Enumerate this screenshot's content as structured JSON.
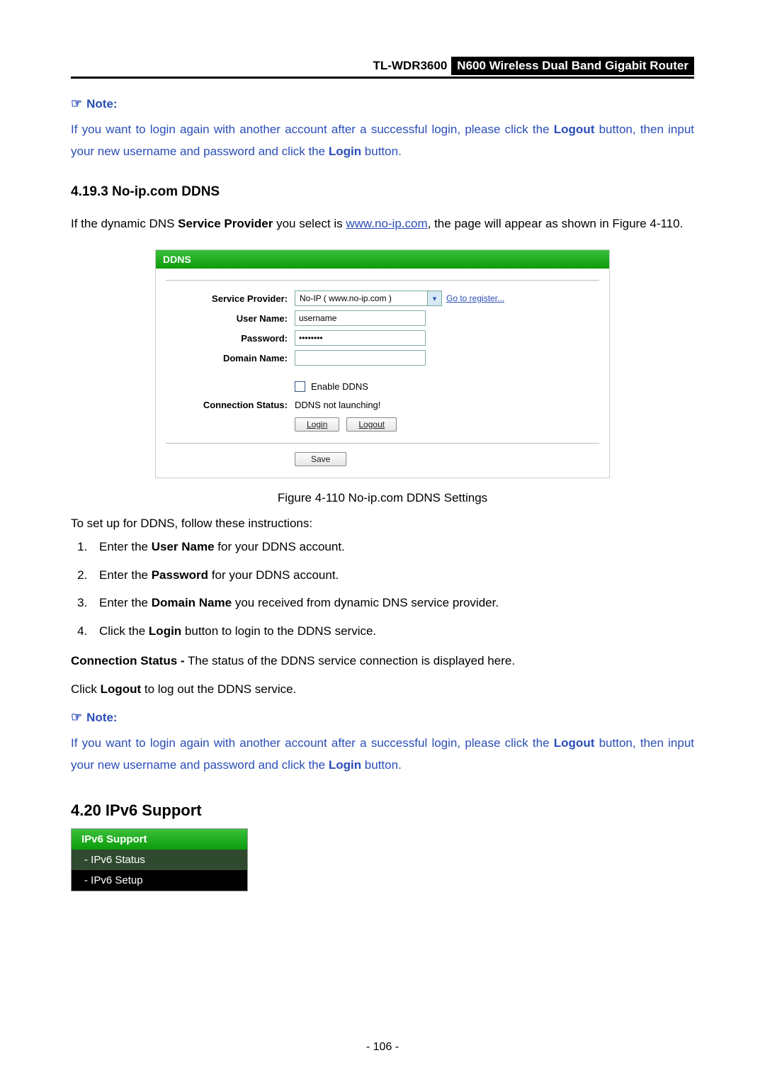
{
  "header": {
    "model": "TL-WDR3600",
    "product": "N600 Wireless Dual Band Gigabit Router"
  },
  "note1": {
    "label": "Note:",
    "prefix": " If you want to login again with another account after a successful login, please click the ",
    "logout": "Logout",
    "mid": " button, then input your new username and password and click the ",
    "login": "Login",
    "suffix": " button."
  },
  "section": {
    "heading": "4.19.3  No-ip.com DDNS",
    "intro_pre": "If the dynamic DNS ",
    "intro_sp": "Service Provider",
    "intro_mid": " you select is ",
    "intro_link": "www.no-ip.com",
    "intro_post": ", the page will appear as shown in Figure 4-110."
  },
  "ddns": {
    "panel_title": "DDNS",
    "labels": {
      "service_provider": "Service Provider:",
      "user_name": "User Name:",
      "password": "Password:",
      "domain_name": "Domain Name:",
      "connection_status": "Connection Status:"
    },
    "fields": {
      "provider_option": "No-IP ( www.no-ip.com )",
      "register_link": "Go to register...",
      "user_name_value": "username",
      "password_value": "••••••••",
      "domain_value": "",
      "enable_label": "Enable DDNS",
      "status_text": "DDNS not launching!"
    },
    "buttons": {
      "login": "Login",
      "logout": "Logout",
      "save": "Save"
    }
  },
  "caption": "Figure 4-110 No-ip.com DDNS Settings",
  "setup_intro": "To set up for DDNS, follow these instructions:",
  "steps": [
    {
      "pre": "Enter the ",
      "bold": "User Name",
      "post": " for your DDNS account."
    },
    {
      "pre": "Enter the ",
      "bold": "Password",
      "post": " for your DDNS account."
    },
    {
      "pre": "Enter the ",
      "bold": "Domain Name",
      "post": " you received from dynamic DNS service provider."
    },
    {
      "pre": "Click the ",
      "bold": "Login",
      "post": " button to login to the DDNS service."
    }
  ],
  "conn_status": {
    "bold": "Connection Status -",
    "rest": " The status of the DDNS service connection is displayed here."
  },
  "logout_line": {
    "pre": "Click ",
    "bold": "Logout",
    "post": " to log out the DDNS service."
  },
  "note2": {
    "label": "Note:",
    "prefix": "If you want to login again with another account after a successful login, please click the ",
    "logout": "Logout",
    "mid": " button, then input your new username and password and click the ",
    "login": "Login",
    "suffix": " button."
  },
  "ipv6": {
    "heading": "4.20  IPv6 Support",
    "menu_title": "IPv6 Support",
    "item1": "- IPv6 Status",
    "item2": "- IPv6 Setup"
  },
  "page_number": "- 106 -"
}
